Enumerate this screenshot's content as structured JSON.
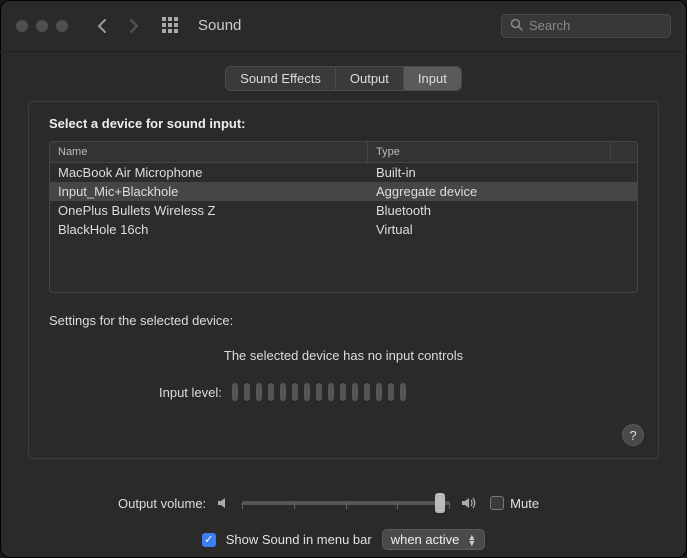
{
  "header": {
    "title": "Sound",
    "search_placeholder": "Search"
  },
  "tabs": {
    "sound_effects": "Sound Effects",
    "output": "Output",
    "input": "Input",
    "active": "input"
  },
  "panel": {
    "prompt": "Select a device for sound input:",
    "columns": {
      "name": "Name",
      "type": "Type"
    },
    "devices": [
      {
        "name": "MacBook Air Microphone",
        "type": "Built-in",
        "selected": false
      },
      {
        "name": "Input_Mic+Blackhole",
        "type": "Aggregate device",
        "selected": true
      },
      {
        "name": "OnePlus Bullets Wireless Z",
        "type": "Bluetooth",
        "selected": false
      },
      {
        "name": "BlackHole 16ch",
        "type": "Virtual",
        "selected": false
      }
    ],
    "settings_heading": "Settings for the selected device:",
    "no_controls_msg": "The selected device has no input controls",
    "input_level_label": "Input level:",
    "help_label": "?"
  },
  "footer": {
    "output_volume_label": "Output volume:",
    "volume_percent": 95,
    "mute_label": "Mute",
    "mute_checked": false,
    "show_in_menubar_label": "Show Sound in menu bar",
    "show_in_menubar_checked": true,
    "menubar_mode": "when active"
  },
  "icons": {
    "search": "search-icon",
    "back": "chevron-left-icon",
    "forward": "chevron-right-icon",
    "apps": "grid-icon",
    "speaker_low": "speaker-low-icon",
    "speaker_high": "speaker-high-icon"
  }
}
